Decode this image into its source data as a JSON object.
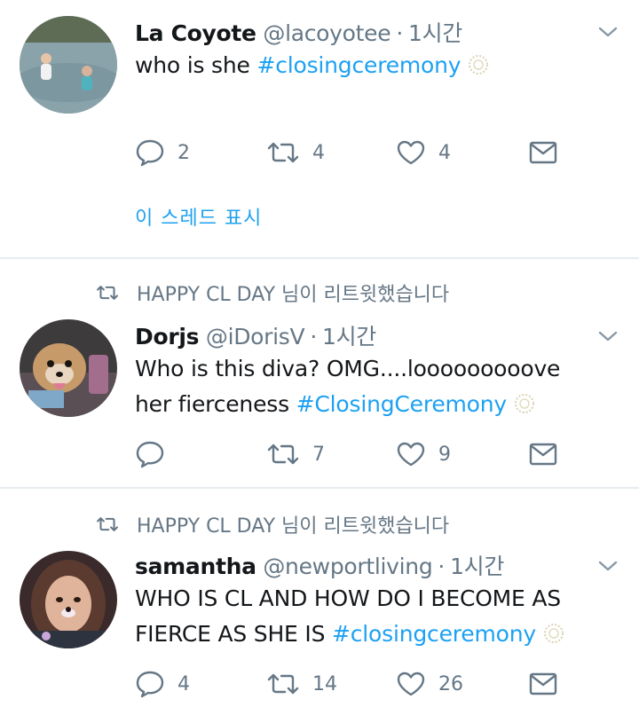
{
  "colors": {
    "accent": "#1da1f2",
    "secondary": "#657786",
    "divider": "#e6ecf0"
  },
  "tweets": [
    {
      "name": "La Coyote",
      "handle": "@lacoyotee",
      "separator": "·",
      "time": "1시간",
      "text_plain": "who is she ",
      "hashtag": "#closingceremony",
      "replies": "2",
      "retweets": "4",
      "likes": "4",
      "thread_link": "이 스레드 표시"
    },
    {
      "retweeted_by": "HAPPY CL DAY 님이 리트윗했습니다",
      "name": "Dorjs",
      "handle": "@iDorisV",
      "separator": "·",
      "time": "1시간",
      "line1": "Who is this diva? OMG....looooooooove",
      "line2_plain": "her fierceness ",
      "hashtag": "#ClosingCeremony",
      "replies": "",
      "retweets": "7",
      "likes": "9"
    },
    {
      "retweeted_by": "HAPPY CL DAY 님이 리트윗했습니다",
      "name": "samantha",
      "handle": "@newportliving",
      "separator": "·",
      "time": "1시간",
      "line1": "WHO IS CL AND HOW DO I BECOME AS",
      "line2_plain": "FIERCE AS SHE IS ",
      "hashtag": "#closingceremony",
      "replies": "4",
      "retweets": "14",
      "likes": "26"
    }
  ],
  "icons": [
    "reply-icon",
    "retweet-icon",
    "like-icon",
    "dm-icon",
    "chevron-down-icon",
    "ceremony-badge-icon"
  ]
}
